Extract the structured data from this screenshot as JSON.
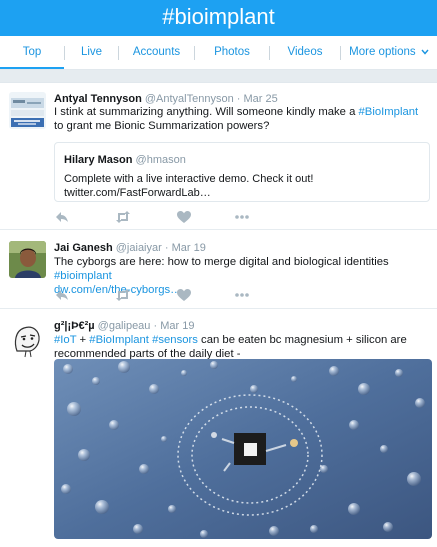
{
  "header": {
    "title": "#bioimplant"
  },
  "tabs": [
    {
      "label": "Top"
    },
    {
      "label": "Live"
    },
    {
      "label": "Accounts"
    },
    {
      "label": "Photos"
    },
    {
      "label": "Videos"
    },
    {
      "label": "More options"
    }
  ],
  "tweets": [
    {
      "name": "Antyal Tennyson",
      "handle": "@AntyalTennyson",
      "time": "Mar 25",
      "text_parts": [
        "I stink at summarizing anything. Will someone kindly make a ",
        "#BioImplant",
        " to grant me Bionic Summarization powers?"
      ],
      "quote": {
        "name": "Hilary Mason",
        "handle": "@hmason",
        "line1": "Complete with a live interactive demo. Check it out!",
        "line2": "twitter.com/FastForwardLab…"
      }
    },
    {
      "name": "Jai Ganesh",
      "handle": "@jaiaiyar",
      "time": "Mar 19",
      "text_parts": [
        "The cyborgs are here: how to merge digital and biological identities ",
        "#bioimplant"
      ],
      "link": "dw.com/en/the-cyborgs…"
    },
    {
      "name": "g²|¡Þ€²µ",
      "handle": "@galipeau",
      "time": "Mar 19",
      "text_parts": [
        "#IoT",
        " + ",
        "#BioImplant",
        " ",
        "#sensors",
        " can be eaten bc magnesium + silicon are recommended parts of the daily diet -"
      ]
    }
  ],
  "separators": {
    "dot": "·"
  },
  "colors": {
    "brand": "#1da1f2",
    "link": "#1b95e0",
    "muted": "#8899a6",
    "icon": "#aab8c2"
  },
  "icons": [
    "reply-icon",
    "retweet-icon",
    "like-icon",
    "more-icon",
    "chevron-down-icon"
  ]
}
